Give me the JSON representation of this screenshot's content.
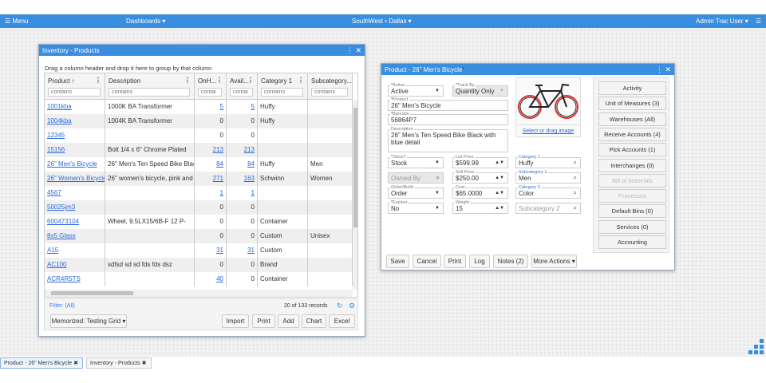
{
  "topbar": {
    "menu": "☰ Menu",
    "dashboards": "Dashboards ▾",
    "location": "SouthWest • Dallas ▾",
    "user": "Admin Trac User ▾",
    "app_icon": "☰"
  },
  "inventory": {
    "title": "Inventory - Products",
    "group_hint": "Drag a column header and drop it here to group by that column",
    "columns": [
      {
        "label": "Product ↑",
        "filter": "contains"
      },
      {
        "label": "Description",
        "filter": "contains"
      },
      {
        "label": "OnH...",
        "filter": "contai"
      },
      {
        "label": "Avail...",
        "filter": "contai"
      },
      {
        "label": "Category 1",
        "filter": "contains"
      },
      {
        "label": "Subcategory...",
        "filter": "contains"
      }
    ],
    "rows": [
      [
        "1001kba",
        "1000K BA Transformer",
        "5",
        "5",
        "Huffy",
        ""
      ],
      [
        "1004kba",
        "1004K BA Transformer",
        "0",
        "0",
        "Huffy",
        ""
      ],
      [
        "12345",
        "",
        "0",
        "0",
        "",
        ""
      ],
      [
        "15156",
        "Bolt 1/4 x 6\" Chrome Plated",
        "213",
        "213",
        "",
        ""
      ],
      [
        "26\" Men's Bicycle",
        "26\" Men's Ten Speed Bike Black...",
        "84",
        "84",
        "Huffy",
        "Men"
      ],
      [
        "26\" Women's Bicycle",
        "26\" women's bicycle, pink and w...",
        "271",
        "163",
        "Schwinn",
        "Women"
      ],
      [
        "4567",
        "",
        "1",
        "1",
        "",
        ""
      ],
      [
        "50025jm3",
        "",
        "0",
        "0",
        "",
        ""
      ],
      [
        "600473104",
        "Wheel, 9.5LX15/6B-F 12 P-",
        "0",
        "0",
        "Container",
        ""
      ],
      [
        "8x5 Glass",
        "",
        "0",
        "0",
        "Custom",
        "Unisex"
      ],
      [
        "A15",
        "",
        "31",
        "31",
        "Custom",
        ""
      ],
      [
        "AC100",
        "sdfsd sd sd fds fds dsz",
        "0",
        "0",
        "Brand",
        ""
      ],
      [
        "ACR4R5TS",
        "",
        "40",
        "0",
        "Container",
        ""
      ]
    ],
    "filter": "Filter: (All)",
    "records": "20 of 133 records",
    "memorized": "Memorized: Testing Grid ▾",
    "buttons": {
      "import": "Import",
      "print": "Print",
      "add": "Add",
      "chart": "Chart",
      "excel": "Excel"
    }
  },
  "product": {
    "title": "Product - 26\" Men's Bicycle",
    "active": {
      "label": "Active",
      "value": "Active"
    },
    "track_by": {
      "label": "Track By",
      "value": "Quantity Only"
    },
    "product": {
      "label": "Product",
      "value": "26\" Men's Bicycle"
    },
    "barcode": {
      "label": "Barcode",
      "value": "56864P7"
    },
    "description": {
      "label": "Description",
      "value": "26\" Men's Ten Speed Bike Black with blue detail"
    },
    "stock": {
      "label": "Stock?",
      "value": "Stock"
    },
    "owned_by": {
      "placeholder": "Owned By"
    },
    "order_build": {
      "label": "Order/Build",
      "value": "Order"
    },
    "expires": {
      "label": "Expires",
      "value": "No"
    },
    "list_price": {
      "label": "List Price",
      "value": "$599.99"
    },
    "sell_price": {
      "label": "Sell Price",
      "value": "$250.00"
    },
    "cost": {
      "label": "Cost",
      "value": "$65.0000"
    },
    "weight": {
      "label": "Weight",
      "value": "15"
    },
    "category1": {
      "label": "Category 1",
      "value": "Huffy"
    },
    "subcategory1": {
      "label": "Subcategory 1",
      "value": "Men"
    },
    "category2": {
      "label": "Category 2",
      "value": "Color"
    },
    "subcategory2": {
      "placeholder": "Subcategory 2"
    },
    "image_link": "Select or drag image",
    "side_buttons": [
      "Activity",
      "Unit of Measures  (3)",
      "Warehouses  (All)",
      "Receive Accounts  (4)",
      "Pick Accounts  (1)",
      "Interchanges  (0)",
      "Bill of Materials",
      "Processes",
      "Default Bins  (0)",
      "Services  (0)",
      "Accounting"
    ],
    "footer": {
      "save": "Save",
      "cancel": "Cancel",
      "print": "Print",
      "log": "Log",
      "notes": "Notes  (2)",
      "more": "More Actions ▾"
    }
  },
  "taskbar": [
    {
      "label": "Product - 26\" Men's Bicycle ✖"
    },
    {
      "label": "Inventory - Products ✖"
    }
  ],
  "colors": {
    "accent": "#3a8ee0",
    "link": "#2a6ad8"
  }
}
